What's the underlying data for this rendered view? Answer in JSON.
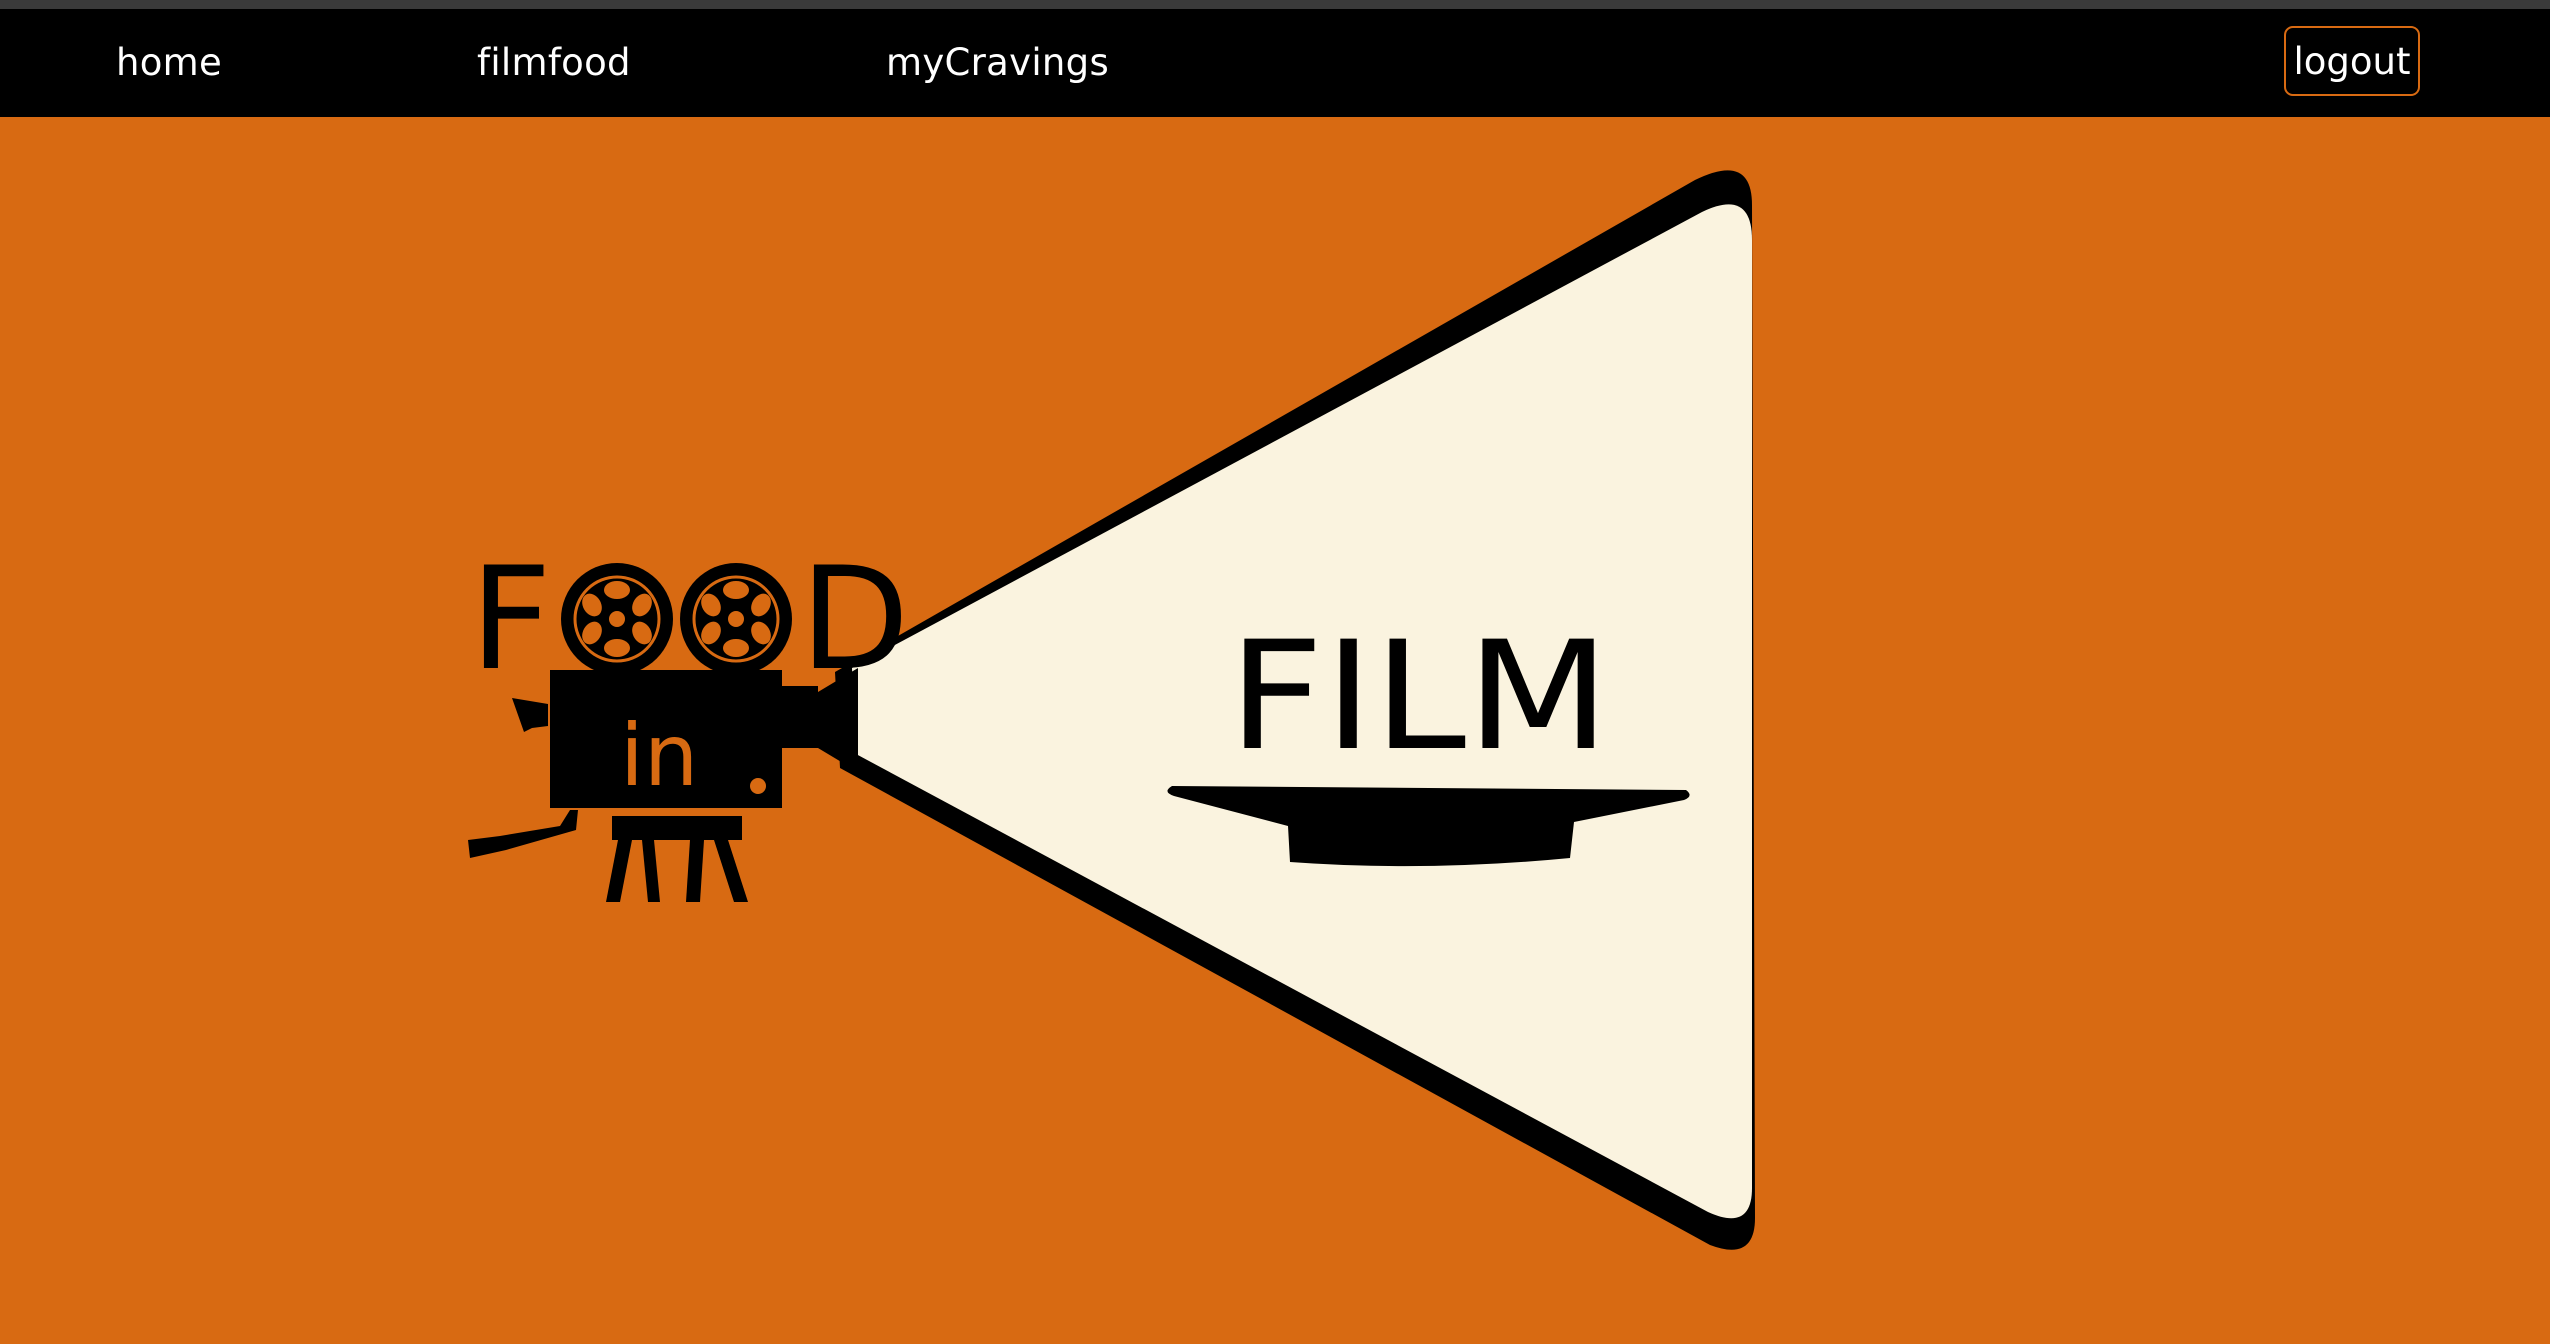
{
  "nav": {
    "items": [
      {
        "label": "home"
      },
      {
        "label": "filmfood"
      },
      {
        "label": "myCravings"
      }
    ],
    "logout_label": "logout"
  },
  "hero": {
    "logo_word_food": "FOOD",
    "logo_word_in": "in",
    "logo_word_film": "FILM",
    "icons": [
      "film-camera-icon",
      "film-reel-icon",
      "plate-icon"
    ]
  },
  "colors": {
    "background": "#d86a12",
    "navbar": "#000000",
    "screen": "#faf3df",
    "ink": "#000000"
  }
}
